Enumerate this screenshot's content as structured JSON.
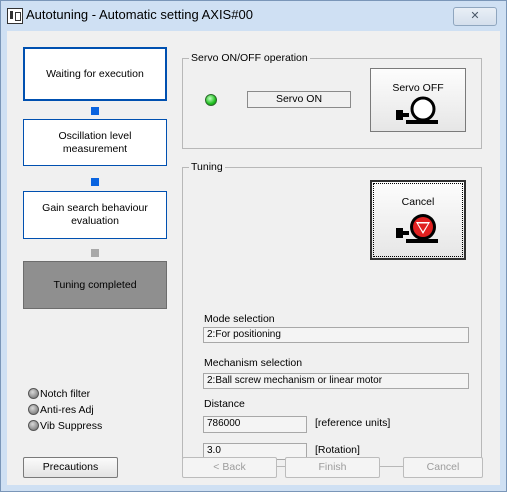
{
  "window": {
    "title": "Autotuning - Automatic setting AXIS#00",
    "close_glyph": "✕"
  },
  "steps": [
    {
      "label": "Waiting for execution",
      "state": "active"
    },
    {
      "label": "Oscillation level measurement",
      "state": "pending"
    },
    {
      "label": "Gain search behaviour evaluation",
      "state": "pending"
    },
    {
      "label": "Tuning completed",
      "state": "disabled"
    }
  ],
  "servo": {
    "group_title": "Servo ON/OFF operation",
    "status_text": "Servo ON",
    "led_color": "#20c020",
    "button_label": "Servo OFF",
    "button_icon": "servo-motor-icon"
  },
  "tuning": {
    "group_title": "Tuning",
    "cancel_label": "Cancel",
    "cancel_icon": "stop-motor-icon",
    "mode_label": "Mode selection",
    "mode_value": "2:For positioning",
    "mechanism_label": "Mechanism selection",
    "mechanism_value": "2:Ball screw mechanism or linear motor",
    "distance_label": "Distance",
    "distance_value": "786000",
    "distance_unit": "[reference units]",
    "rotation_value": "3.0",
    "rotation_unit": "[Rotation]"
  },
  "indicators": [
    {
      "label": "Notch filter"
    },
    {
      "label": "Anti-res Adj"
    },
    {
      "label": "Vib Suppress"
    }
  ],
  "buttons": {
    "precautions": "Precautions",
    "back": "< Back",
    "finish": "Finish",
    "cancel": "Cancel"
  },
  "colors": {
    "accent": "#0050b0",
    "connector": "#0a64e0",
    "motor_red": "#e02020"
  }
}
